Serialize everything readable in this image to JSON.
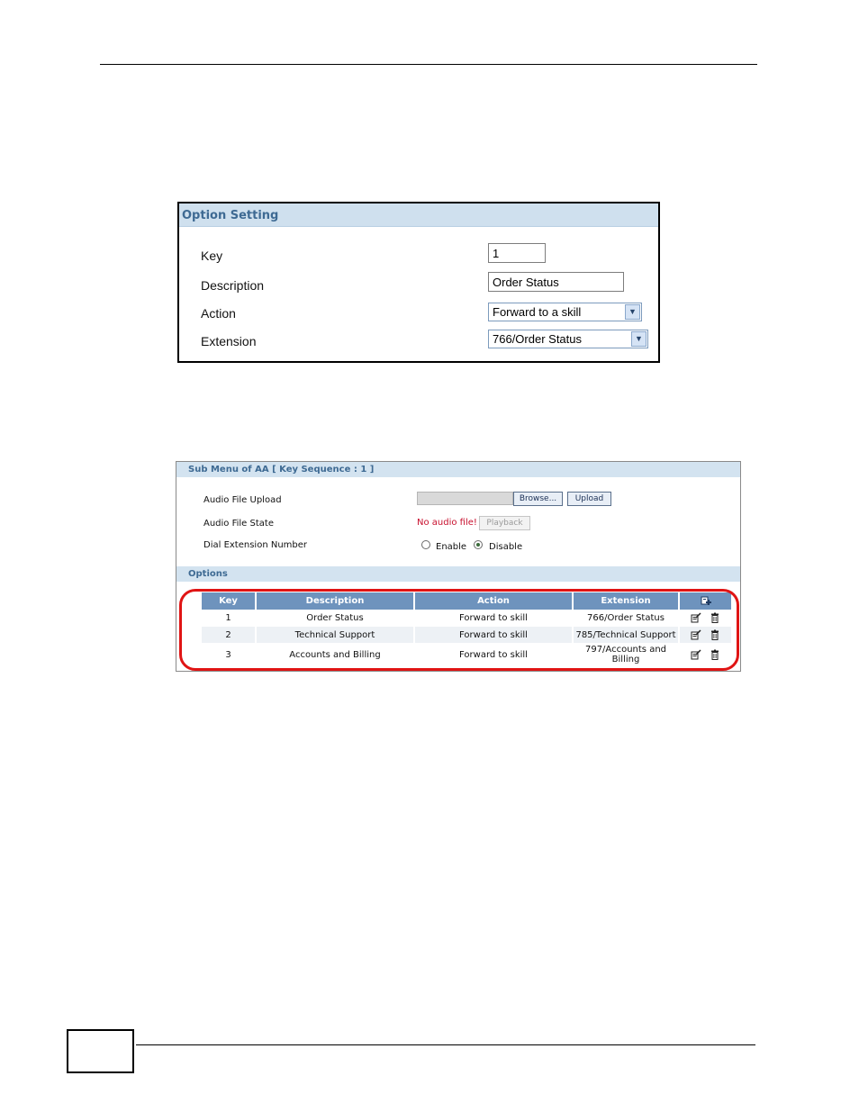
{
  "option_setting": {
    "title": "Option Setting",
    "fields": {
      "key_label": "Key",
      "key_value": "1",
      "description_label": "Description",
      "description_value": "Order Status",
      "action_label": "Action",
      "action_value": "Forward to a skill",
      "extension_label": "Extension",
      "extension_value": "766/Order Status"
    }
  },
  "submenu": {
    "title": "Sub Menu of AA [ Key Sequence : 1 ]",
    "audio_file_upload_label": "Audio File Upload",
    "browse_label": "Browse...",
    "upload_label": "Upload",
    "audio_file_state_label": "Audio File State",
    "no_audio_text": "No audio file!",
    "playback_label": "Playback",
    "dial_extension_label": "Dial Extension Number",
    "enable_label": "Enable",
    "disable_label": "Disable",
    "dial_extension_selected": "Disable",
    "options_title": "Options",
    "table": {
      "headers": [
        "Key",
        "Description",
        "Action",
        "Extension"
      ],
      "add_icon": "add-icon",
      "rows": [
        {
          "key": "1",
          "description": "Order Status",
          "action": "Forward to skill",
          "extension": "766/Order Status"
        },
        {
          "key": "2",
          "description": "Technical Support",
          "action": "Forward to skill",
          "extension": "785/Technical Support"
        },
        {
          "key": "3",
          "description": "Accounts and Billing",
          "action": "Forward to skill",
          "extension": "797/Accounts and Billing"
        }
      ],
      "row_icons": [
        "edit-icon",
        "delete-icon"
      ]
    }
  },
  "colors": {
    "header_bar": "#cfe0ee",
    "header_text": "#3e6a93",
    "table_header": "#6e93bd",
    "highlight": "#e01414",
    "error_text": "#c8102e"
  }
}
